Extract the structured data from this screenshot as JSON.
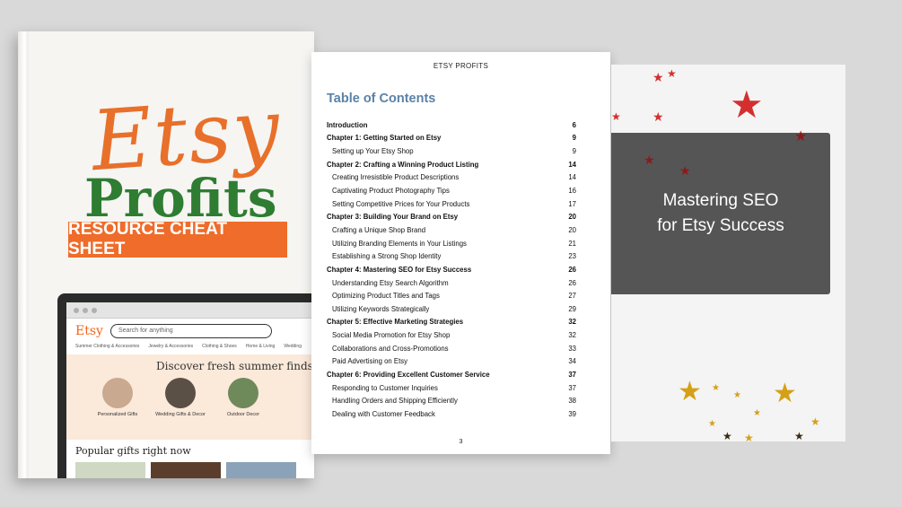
{
  "cover": {
    "title_script": "Etsy",
    "title_main": "Profits",
    "banner": "RESOURCE CHEAT SHEET",
    "etsy_screen": {
      "logo": "Etsy",
      "search_placeholder": "Search for anything",
      "categories": [
        "Summer Clothing & Accessories",
        "Jewelry & Accessories",
        "Clothing & Shoes",
        "Home & Living",
        "Wedding"
      ],
      "hero_text": "Discover fresh summer finds",
      "circles": [
        "Personalized Gifts",
        "Wedding Gifts & Decor",
        "Outdoor Decor"
      ],
      "popular_heading": "Popular gifts right now"
    }
  },
  "document": {
    "header": "ETSY PROFITS",
    "toc_title": "Table of Contents",
    "page_number": "3",
    "entries": [
      {
        "text": "Introduction",
        "page": "6",
        "chapter": true
      },
      {
        "text": "Chapter 1: Getting Started on Etsy",
        "page": "9",
        "chapter": true
      },
      {
        "text": "Setting up Your Etsy Shop",
        "page": "9",
        "chapter": false
      },
      {
        "text": "Chapter 2: Crafting a Winning Product Listing",
        "page": "14",
        "chapter": true
      },
      {
        "text": "Creating Irresistible Product Descriptions",
        "page": "14",
        "chapter": false
      },
      {
        "text": "Captivating Product Photography Tips",
        "page": "16",
        "chapter": false
      },
      {
        "text": "Setting Competitive Prices for Your Products",
        "page": "17",
        "chapter": false
      },
      {
        "text": "Chapter 3: Building Your Brand on Etsy",
        "page": "20",
        "chapter": true
      },
      {
        "text": "Crafting a Unique Shop Brand",
        "page": "20",
        "chapter": false
      },
      {
        "text": "Utilizing Branding Elements in Your Listings",
        "page": "21",
        "chapter": false
      },
      {
        "text": "Establishing a Strong Shop Identity",
        "page": "23",
        "chapter": false
      },
      {
        "text": "Chapter 4: Mastering SEO for Etsy Success",
        "page": "26",
        "chapter": true
      },
      {
        "text": "Understanding Etsy Search Algorithm",
        "page": "26",
        "chapter": false
      },
      {
        "text": "Optimizing Product Titles and Tags",
        "page": "27",
        "chapter": false
      },
      {
        "text": "Utilizing Keywords Strategically",
        "page": "29",
        "chapter": false
      },
      {
        "text": "Chapter 5: Effective Marketing Strategies",
        "page": "32",
        "chapter": true
      },
      {
        "text": "Social Media Promotion for Etsy Shop",
        "page": "32",
        "chapter": false
      },
      {
        "text": "Collaborations and Cross-Promotions",
        "page": "33",
        "chapter": false
      },
      {
        "text": "Paid Advertising on Etsy",
        "page": "34",
        "chapter": false
      },
      {
        "text": "Chapter 6: Providing Excellent Customer Service",
        "page": "37",
        "chapter": true
      },
      {
        "text": "Responding to Customer Inquiries",
        "page": "37",
        "chapter": false
      },
      {
        "text": "Handling Orders and Shipping Efficiently",
        "page": "38",
        "chapter": false
      },
      {
        "text": "Dealing with Customer Feedback",
        "page": "39",
        "chapter": false
      }
    ]
  },
  "slide": {
    "line1": "Mastering SEO",
    "line2": "for Etsy Success"
  },
  "colors": {
    "background": "#d9d9d9",
    "script_orange": "#e8702a",
    "profits_green": "#2e7d32",
    "banner_orange": "#ef6c2a",
    "toc_blue": "#5a82a8",
    "slide_box": "#555555",
    "star_red": "#d32f2f",
    "star_gold": "#d4a017"
  }
}
